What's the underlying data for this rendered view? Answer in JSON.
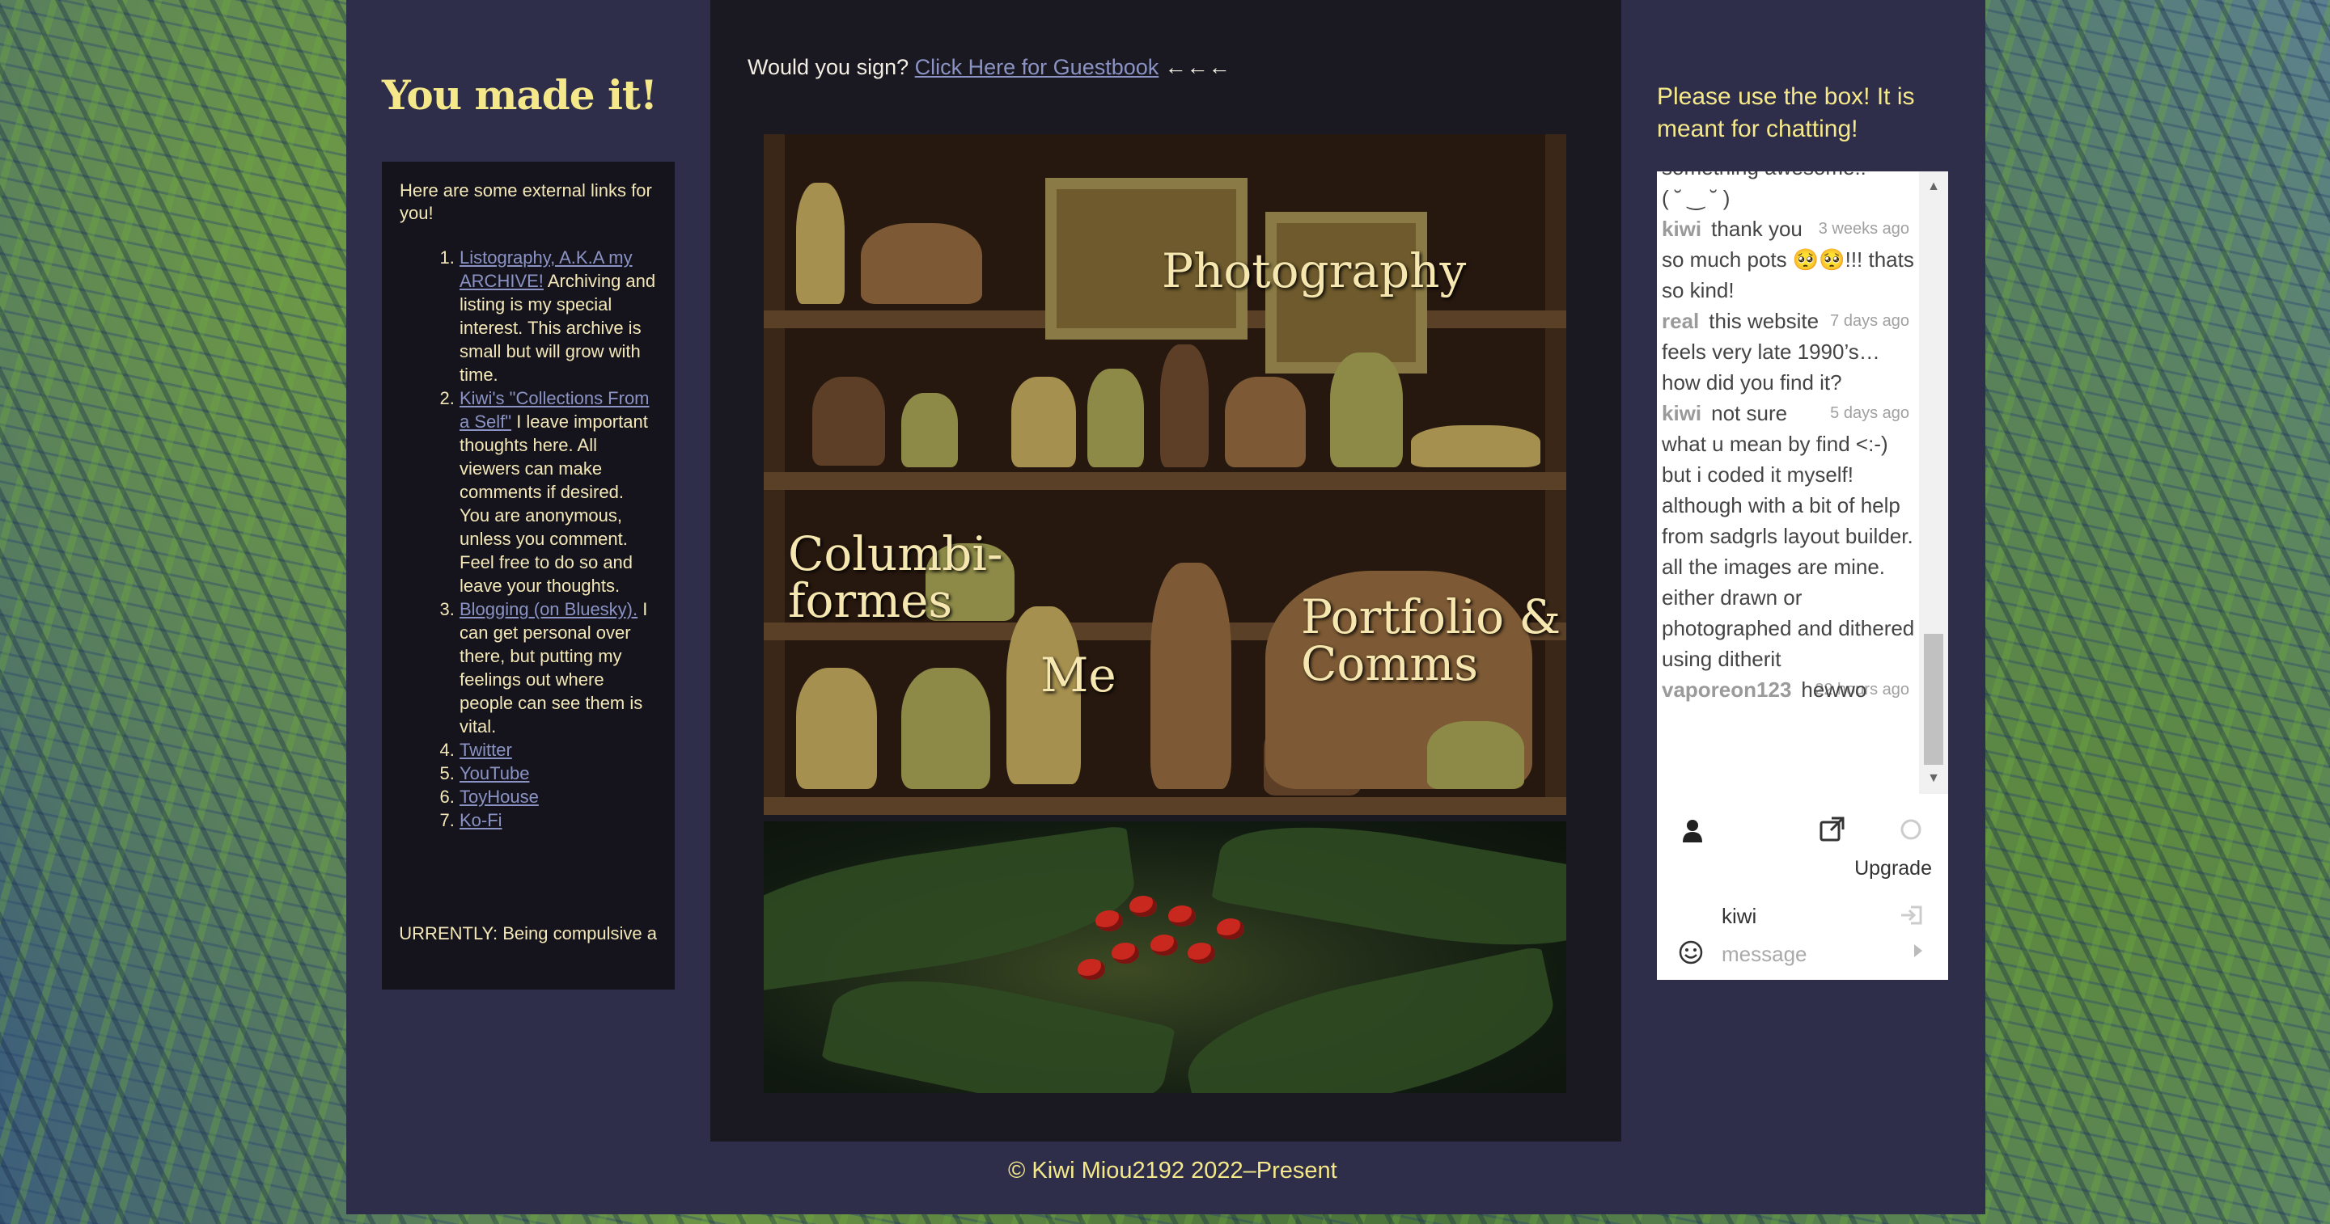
{
  "page": {
    "left_title": "You made it!",
    "footer": "© Kiwi Miou2192 2022–Present"
  },
  "links_box": {
    "intro": "Here are some external links for you!",
    "items": [
      {
        "link": "Listography, A.K.A my ARCHIVE!",
        "desc": " Archiving and listing is my special interest. This archive is small but will grow with time."
      },
      {
        "link": "Kiwi's \"Collections From a Self\"",
        "desc": " I leave important thoughts here. All viewers can make comments if desired. You are anonymous, unless you comment. Feel free to do so and leave your thoughts."
      },
      {
        "link": "Blogging (on Bluesky).",
        "desc": " I can get personal over there, but putting my feelings out where people can see them is vital."
      },
      {
        "link": "Twitter",
        "desc": ""
      },
      {
        "link": "YouTube",
        "desc": ""
      },
      {
        "link": "ToyHouse",
        "desc": ""
      },
      {
        "link": "Ko-Fi",
        "desc": ""
      }
    ],
    "marquee": "CURRENTLY: Being compulsive a"
  },
  "center": {
    "guestbook_prompt": "Would you sign? ",
    "guestbook_link": "Click Here for Guestbook",
    "guestbook_arrows": " ←←←",
    "shelf_labels": {
      "photography": "Photography",
      "columbiformes_1": "Columbi-",
      "columbiformes_2": "formes",
      "me": "Me",
      "portfolio_1": "Portfolio &",
      "portfolio_2": "Comms"
    }
  },
  "chat": {
    "heading": "Please use the box! It is meant for chatting!",
    "partial_top": "something awesome!!",
    "partial_emoticon": "( ˘ ‿ ˘ )",
    "messages": [
      {
        "author": "kiwi",
        "time": "3 weeks ago",
        "text": "thank you so much pots 🥺🥺!!! thats so kind!"
      },
      {
        "author": "real",
        "time": "7 days ago",
        "text": "this website feels very late 1990’s… how did you find it?"
      },
      {
        "author": "kiwi",
        "time": "5 days ago",
        "text": "not sure what u mean by find <:-) but i coded it myself! although with a bit of help from sadgrls layout builder. all the images are mine. either drawn or photographed and dithered using ditherit"
      },
      {
        "author": "vaporeon123",
        "time": "22 hours ago",
        "text": "hewwo"
      }
    ],
    "upgrade": "Upgrade",
    "username": "kiwi",
    "message_placeholder": "message",
    "icons": {
      "user": "user-icon",
      "popout": "external-link-icon",
      "status": "status-circle-icon",
      "login": "login-icon",
      "emoji": "smiley-icon",
      "send": "send-arrow-icon",
      "scroll_up": "▲",
      "scroll_down": "▼"
    }
  }
}
